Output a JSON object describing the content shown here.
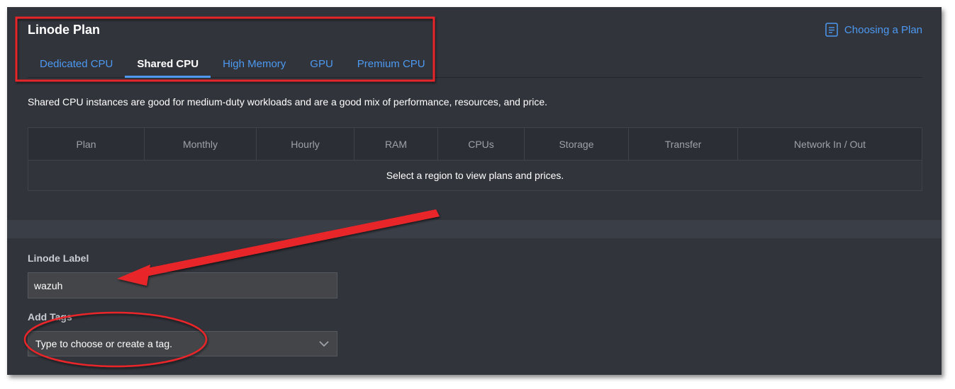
{
  "header": {
    "title": "Linode Plan",
    "doc_link": "Choosing a Plan"
  },
  "tabs": [
    {
      "label": "Dedicated CPU"
    },
    {
      "label": "Shared CPU"
    },
    {
      "label": "High Memory"
    },
    {
      "label": "GPU"
    },
    {
      "label": "Premium CPU"
    }
  ],
  "active_tab": "Shared CPU",
  "description": "Shared CPU instances are good for medium-duty workloads and are a good mix of performance, resources, and price.",
  "plans_table": {
    "columns": [
      "Plan",
      "Monthly",
      "Hourly",
      "RAM",
      "CPUs",
      "Storage",
      "Transfer",
      "Network In / Out"
    ],
    "empty_message": "Select a region to view plans and prices."
  },
  "linode_label": {
    "label": "Linode Label",
    "value": "wazuh"
  },
  "add_tags": {
    "label": "Add Tags",
    "placeholder": "Type to choose or create a tag."
  },
  "colors": {
    "accent": "#4d99f1",
    "annotation": "#e8262b",
    "background": "#31343b"
  },
  "icons": {
    "doc_link": "document-icon",
    "select": "chevron-down-icon"
  }
}
